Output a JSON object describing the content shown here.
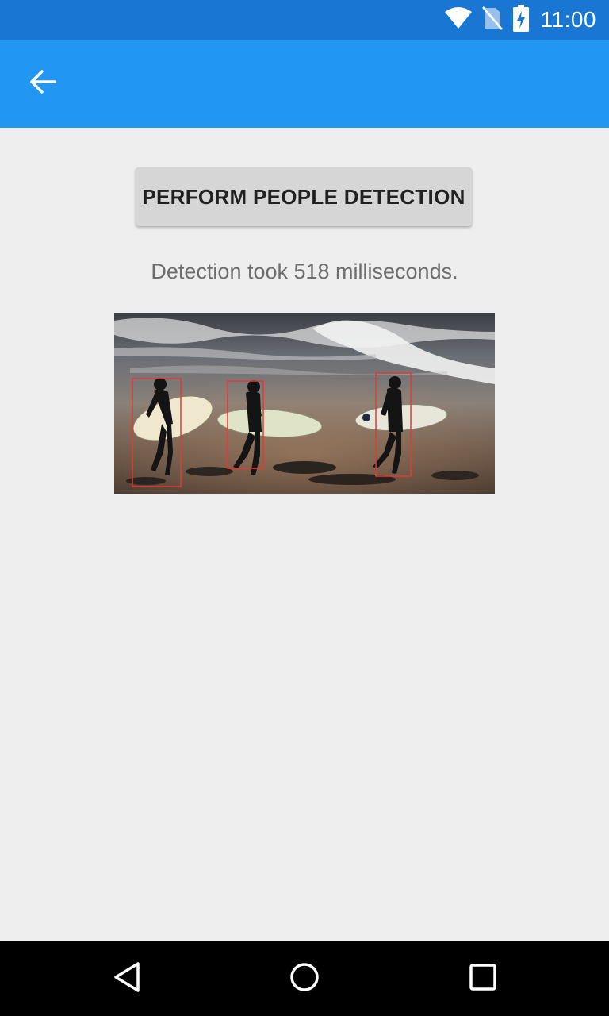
{
  "status_bar": {
    "time": "11:00",
    "icons": [
      "wifi-icon",
      "no-sim-icon",
      "battery-charging-icon"
    ]
  },
  "app_bar": {
    "back_icon": "arrow-back-icon",
    "color": "#2196f3"
  },
  "main": {
    "detect_button_label": "PERFORM PEOPLE DETECTION",
    "result_text": "Detection took 518 milliseconds."
  },
  "navigation_bar": {
    "icons": [
      "back-triangle-icon",
      "home-circle-icon",
      "recents-square-icon"
    ]
  },
  "colors": {
    "status_bar": "#1976d2",
    "app_bar": "#2196f3",
    "background": "#eeeeee",
    "detection_box": "#e53935"
  }
}
